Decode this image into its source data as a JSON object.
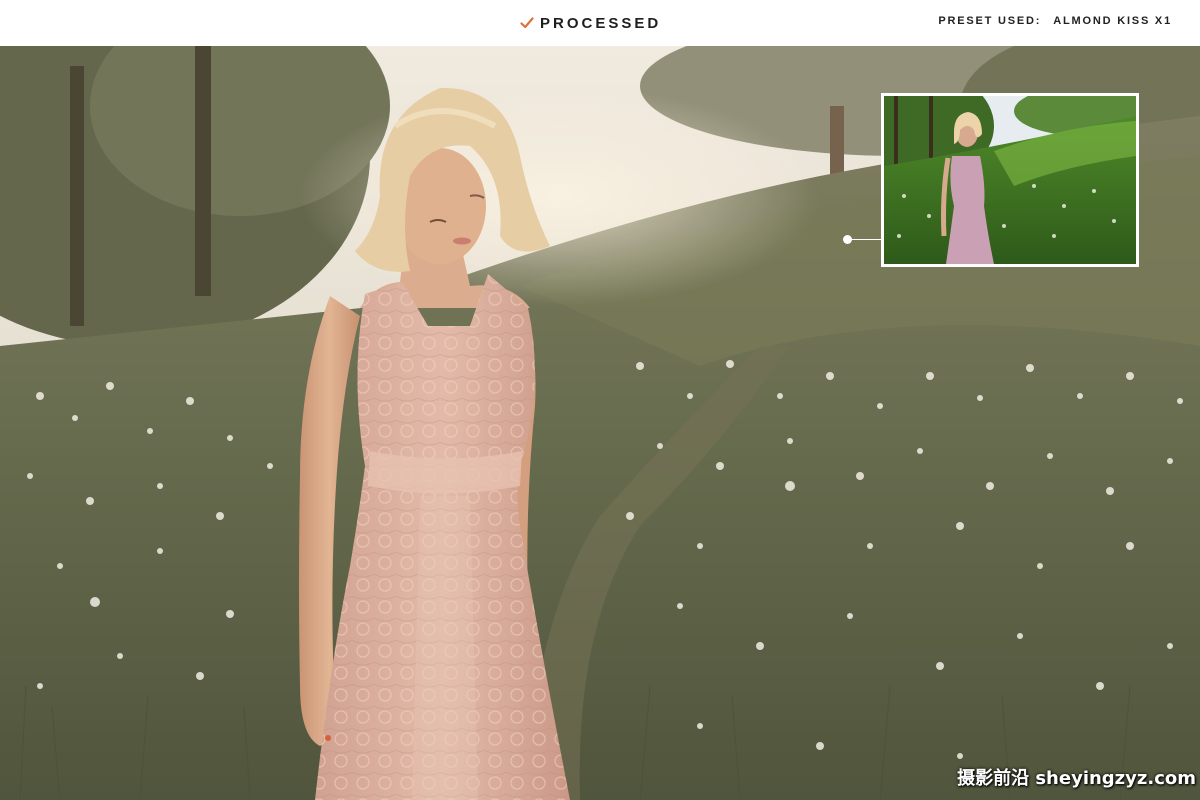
{
  "header": {
    "status_label": "PROCESSED",
    "status_icon": "check-icon",
    "preset_label": "PRESET USED:",
    "preset_value": "ALMOND KISS X1",
    "accent_color": "#e0703a"
  },
  "main_image": {
    "style": "muted warm-toned processed photo",
    "palette": {
      "sky": "#ece6dc",
      "grass": "#5c6248",
      "dress": "#d9a99a",
      "skin": "#d8a585",
      "hair": "#e7cfa6"
    }
  },
  "before_thumbnail": {
    "style": "original vivid green photo",
    "palette": {
      "grass": "#4c8a2a",
      "sky": "#e8eef2",
      "dress": "#c9a0b4"
    }
  },
  "watermark": {
    "text": "摄影前沿 sheyingzyz.com"
  }
}
